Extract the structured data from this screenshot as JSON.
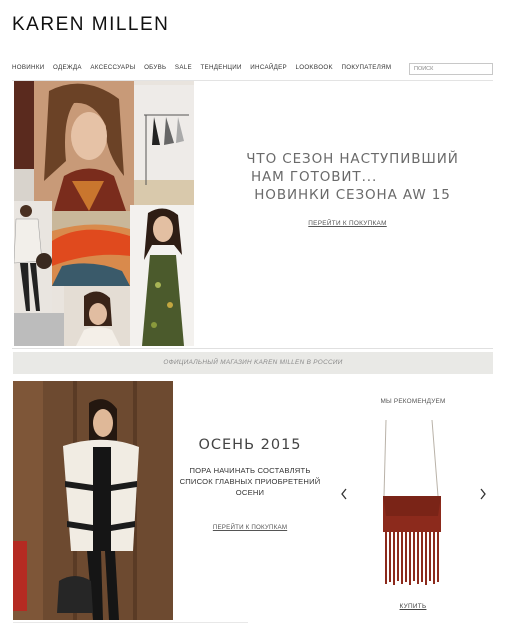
{
  "header": {
    "logo": "KAREN MILLEN",
    "search_placeholder": "ПОИСК"
  },
  "nav": {
    "items": [
      "НОВИНКИ",
      "ОДЕЖДА",
      "АКСЕССУАРЫ",
      "ОБУВЬ",
      "SALE",
      "ТЕНДЕНЦИИ",
      "ИНСАЙДЕР",
      "LOOKBOOK",
      "ПОКУПАТЕЛЯМ"
    ]
  },
  "hero": {
    "line1": "ЧТО СЕЗОН НАСТУПИВШИЙ",
    "line2": "НАМ ГОТОВИТ...",
    "line3": "НОВИНКИ СЕЗОНА AW 15",
    "link": "ПЕРЕЙТИ К ПОКУПКАМ"
  },
  "banner": {
    "text": "ОФИЦИАЛЬНЫЙ МАГАЗИН KAREN MILLEN В РОССИИ"
  },
  "autumn": {
    "title": "ОСЕНЬ 2015",
    "desc": "ПОРА НАЧИНАТЬ СОСТАВЛЯТЬ СПИСОК ГЛАВНЫХ ПРИОБРЕТЕНИЙ ОСЕНИ",
    "link": "ПЕРЕЙТИ К ПОКУПКАМ"
  },
  "recommend": {
    "title": "МЫ РЕКОМЕНДУЕМ",
    "buy": "КУПИТЬ",
    "prev_icon": "chevron-left-icon",
    "next_icon": "chevron-right-icon"
  },
  "colors": {
    "bag": "#8c2a1c",
    "banner_bg": "#e9e9e6",
    "hero_text": "#6a6a6a"
  }
}
